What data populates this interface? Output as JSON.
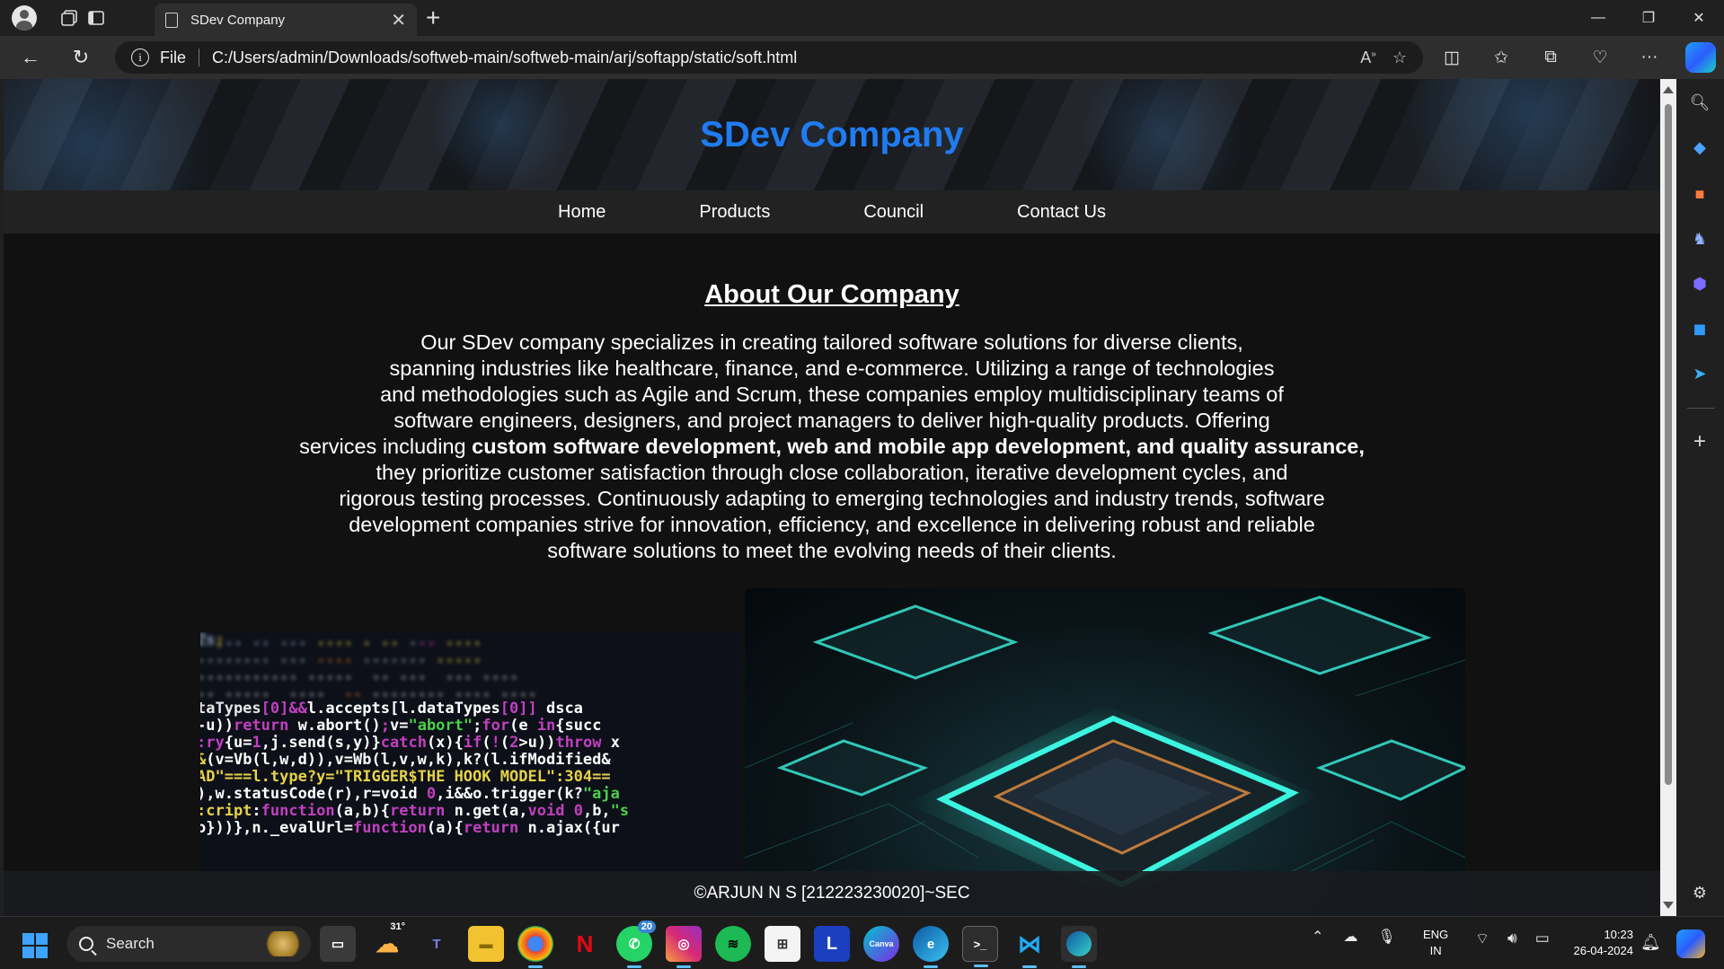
{
  "browser": {
    "tab_title": "SDev Company",
    "tab_close": "✕",
    "new_tab": "+",
    "address_label": "File",
    "url": "C:/Users/admin/Downloads/softweb-main/softweb-main/arj/softapp/static/soft.html"
  },
  "page": {
    "site_title": "SDev Company",
    "menu": [
      "Home",
      "Products",
      "Council",
      "Contact Us"
    ],
    "about_title": "About Our Company",
    "about_lines": [
      "Our SDev company specializes in creating tailored software solutions for diverse clients,",
      "spanning industries like healthcare, finance, and e-commerce. Utilizing a range of technologies",
      "and methodologies such as Agile and Scrum, these companies employ multidisciplinary teams of",
      "software engineers, designers, and project managers to deliver high-quality products. Offering"
    ],
    "about_bold_prefix": "services including ",
    "about_bold": "custom software development, web and mobile app development, and quality assurance,",
    "about_lines_after": [
      "they prioritize customer satisfaction through close collaboration, iterative development cycles, and",
      "rigorous testing processes. Continuously adapting to emerging technologies and industry trends, software",
      "development companies strive for innovation, efficiency, and excellence in delivering robust and reliable",
      "software solutions to meet the evolving needs of their clients."
    ],
    "footer": "©ARJUN N S [212223230020]~SEC"
  },
  "taskbar": {
    "search_label": "Search",
    "weather_temp": "31°",
    "whatsapp_badge": "20",
    "lang_line1": "ENG",
    "lang_line2": "IN",
    "time": "10:23",
    "date": "26-04-2024"
  },
  "colors": {
    "site_title": "#1f7cf2",
    "page_bg": "#111111",
    "menu_bg": "#222222"
  }
}
